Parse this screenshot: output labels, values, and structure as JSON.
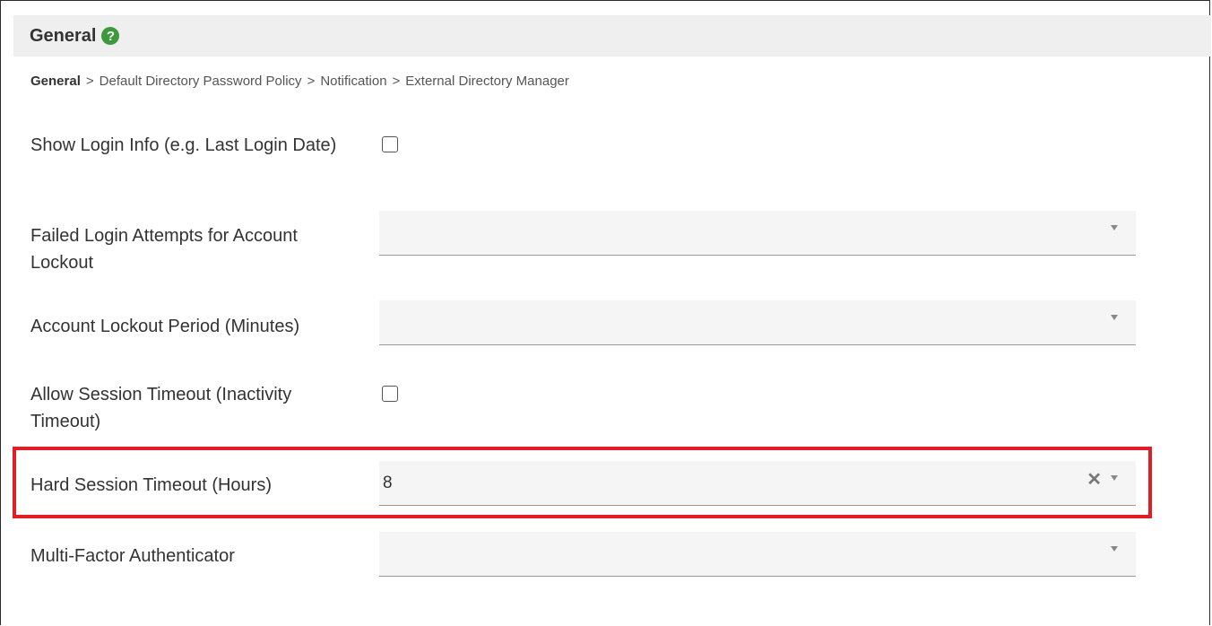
{
  "header": {
    "title": "General",
    "help_icon": "question-circle-icon",
    "help_glyph": "?"
  },
  "breadcrumb": {
    "current": "General",
    "separator": ">",
    "items": [
      "Default Directory Password Policy",
      "Notification",
      "External Directory Manager"
    ]
  },
  "fields": {
    "show_login_info": {
      "label": "Show Login Info (e.g. Last Login Date)",
      "checked": false
    },
    "failed_login_attempts": {
      "label": "Failed Login Attempts for Account Lockout",
      "value": ""
    },
    "account_lockout_period": {
      "label": "Account Lockout Period (Minutes)",
      "value": ""
    },
    "allow_session_timeout": {
      "label": "Allow Session Timeout (Inactivity Timeout)",
      "checked": false
    },
    "hard_session_timeout": {
      "label": "Hard Session Timeout (Hours)",
      "value": "8",
      "clear_glyph": "✕"
    },
    "multi_factor_authenticator": {
      "label": "Multi-Factor Authenticator",
      "value": ""
    }
  },
  "colors": {
    "highlight": "#e01e26",
    "help_icon": "#3c9a3c",
    "header_bg": "#efefef",
    "select_bg": "#f5f5f5"
  }
}
